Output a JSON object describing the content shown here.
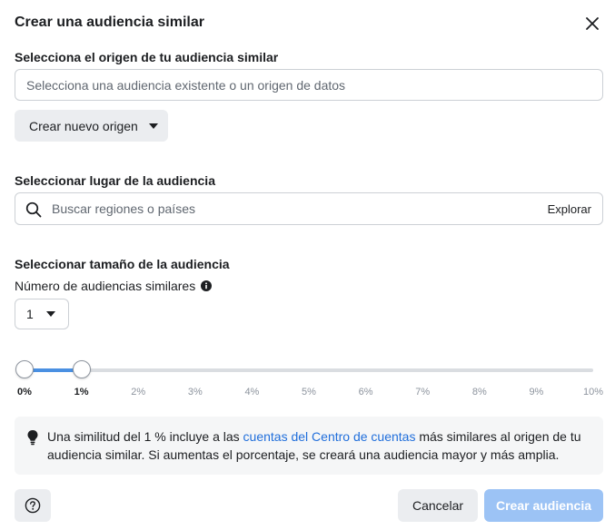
{
  "dialog": {
    "title": "Crear una audiencia similar"
  },
  "origin": {
    "label": "Selecciona el origen de tu audiencia similar",
    "placeholder": "Selecciona una audiencia existente o un origen de datos",
    "value": "",
    "new_origin_button": "Crear nuevo origen"
  },
  "location": {
    "label": "Seleccionar lugar de la audiencia",
    "placeholder": "Buscar regiones o países",
    "value": "",
    "explore_link": "Explorar"
  },
  "size": {
    "label": "Seleccionar tamaño de la audiencia",
    "count_label": "Número de audiencias similares",
    "count_value": "1",
    "slider": {
      "min_percent": 0,
      "max_percent": 10,
      "selected_start_percent": 0,
      "selected_end_percent": 1,
      "ticks": [
        "0%",
        "1%",
        "2%",
        "3%",
        "4%",
        "5%",
        "6%",
        "7%",
        "8%",
        "9%",
        "10%"
      ],
      "active_ticks": [
        "0%",
        "1%"
      ],
      "fill_color": "#4a90e2"
    }
  },
  "hint": {
    "text_before": "Una similitud del 1 % incluye a las ",
    "link_text": "cuentas del Centro de cuentas",
    "text_after": " más similares al origen de tu audiencia similar. Si aumentas el porcentaje, se creará una audiencia mayor y más amplia."
  },
  "footer": {
    "help_icon": "question-circle-icon",
    "cancel_label": "Cancelar",
    "create_label": "Crear audiencia",
    "create_color": "#9cc3f5"
  },
  "icons": {
    "close": "close-icon",
    "search": "search-icon",
    "info": "info-icon",
    "bulb": "lightbulb-icon",
    "caret": "caret-down-icon"
  }
}
